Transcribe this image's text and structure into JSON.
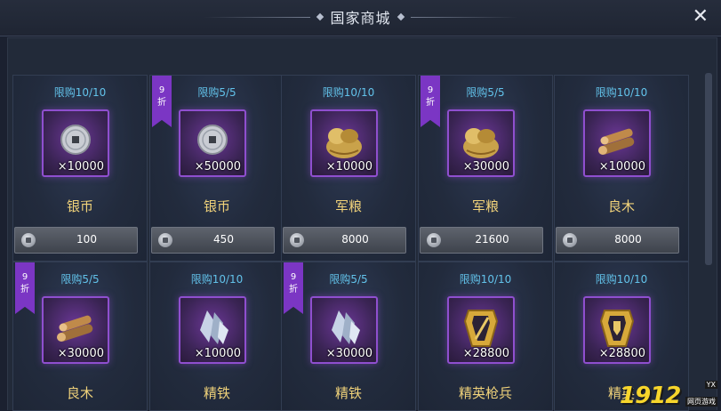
{
  "window": {
    "title": "国家商城"
  },
  "items": [
    {
      "limit": "限购10/10",
      "discount": "",
      "qty": "×10000",
      "name": "银币",
      "price": "100",
      "icon": "silver-coin-icon"
    },
    {
      "limit": "限购5/5",
      "discount": "9折",
      "qty": "×50000",
      "name": "银币",
      "price": "450",
      "icon": "silver-coin-icon"
    },
    {
      "limit": "限购10/10",
      "discount": "",
      "qty": "×10000",
      "name": "军粮",
      "price": "8000",
      "icon": "grain-sack-icon"
    },
    {
      "limit": "限购5/5",
      "discount": "9折",
      "qty": "×30000",
      "name": "军粮",
      "price": "21600",
      "icon": "grain-sack-icon"
    },
    {
      "limit": "限购10/10",
      "discount": "",
      "qty": "×10000",
      "name": "良木",
      "price": "8000",
      "icon": "wood-logs-icon"
    },
    {
      "limit": "限购5/5",
      "discount": "9折",
      "qty": "×30000",
      "name": "良木",
      "icon": "wood-logs-icon"
    },
    {
      "limit": "限购10/10",
      "discount": "",
      "qty": "×10000",
      "name": "精铁",
      "icon": "iron-crystal-icon"
    },
    {
      "limit": "限购5/5",
      "discount": "9折",
      "qty": "×30000",
      "name": "精铁",
      "icon": "iron-crystal-icon"
    },
    {
      "limit": "限购10/10",
      "discount": "",
      "qty": "×28800",
      "name": "精英枪兵",
      "icon": "spear-soldier-badge-icon"
    },
    {
      "limit": "限购10/10",
      "discount": "",
      "qty": "×28800",
      "name": "精英",
      "icon": "shield-soldier-badge-icon"
    }
  ],
  "watermark": {
    "text": "1912",
    "badge": "YX",
    "sub": "网页游戏"
  }
}
